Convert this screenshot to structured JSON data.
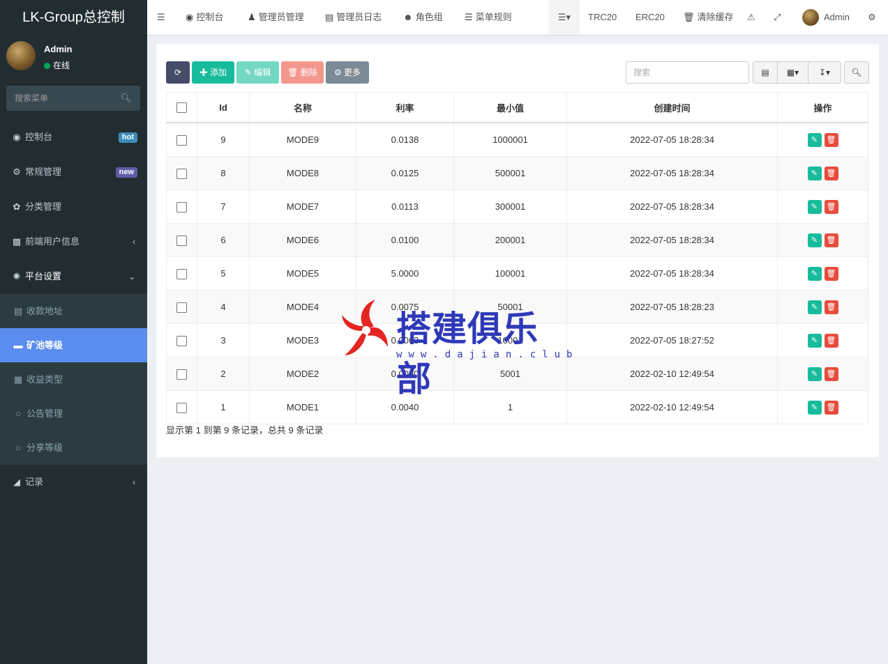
{
  "brand": "LK-Group总控制",
  "user": {
    "name": "Admin",
    "status": "在线"
  },
  "sidebar_search": {
    "placeholder": "搜索菜单"
  },
  "menu": {
    "items": [
      {
        "label": "控制台",
        "icon": "dashboard-icon",
        "badge": "hot"
      },
      {
        "label": "常规管理",
        "icon": "cogs-icon",
        "badge": "new"
      },
      {
        "label": "分类管理",
        "icon": "leaf-icon"
      },
      {
        "label": "前端用户信息",
        "icon": "user-card-icon"
      },
      {
        "label": "平台设置",
        "icon": "settings-icon"
      }
    ],
    "submenu": [
      {
        "label": "收款地址",
        "icon": "address-card-icon"
      },
      {
        "label": "矿池等级",
        "icon": "card-icon"
      },
      {
        "label": "收益类型",
        "icon": "windows-icon"
      },
      {
        "label": "公告管理",
        "icon": "circle-icon"
      },
      {
        "label": "分享等级",
        "icon": "circle-icon"
      }
    ],
    "records": {
      "label": "记录",
      "icon": "area-chart-icon"
    }
  },
  "header": {
    "nav": [
      "控制台",
      "管理员管理",
      "管理员日志",
      "角色组",
      "菜单规则"
    ],
    "trc": "TRC20",
    "erc": "ERC20",
    "clear_cache": "清除缓存",
    "admin": "Admin"
  },
  "toolbar": {
    "add": "添加",
    "edit": "编辑",
    "delete": "删除",
    "more": "更多",
    "search_placeholder": "搜索"
  },
  "table": {
    "columns": [
      "Id",
      "名称",
      "利率",
      "最小值",
      "创建时间",
      "操作"
    ],
    "rows": [
      {
        "id": "9",
        "name": "MODE9",
        "rate": "0.0138",
        "min": "1000001",
        "time": "2022-07-05 18:28:34"
      },
      {
        "id": "8",
        "name": "MODE8",
        "rate": "0.0125",
        "min": "500001",
        "time": "2022-07-05 18:28:34"
      },
      {
        "id": "7",
        "name": "MODE7",
        "rate": "0.0113",
        "min": "300001",
        "time": "2022-07-05 18:28:34"
      },
      {
        "id": "6",
        "name": "MODE6",
        "rate": "0.0100",
        "min": "200001",
        "time": "2022-07-05 18:28:34"
      },
      {
        "id": "5",
        "name": "MODE5",
        "rate": "5.0000",
        "min": "100001",
        "time": "2022-07-05 18:28:34"
      },
      {
        "id": "4",
        "name": "MODE4",
        "rate": "0.0075",
        "min": "50001",
        "time": "2022-07-05 18:28:23"
      },
      {
        "id": "3",
        "name": "MODE3",
        "rate": "0.0063",
        "min": "10001",
        "time": "2022-07-05 18:27:52"
      },
      {
        "id": "2",
        "name": "MODE2",
        "rate": "0.0050",
        "min": "5001",
        "time": "2022-02-10 12:49:54"
      },
      {
        "id": "1",
        "name": "MODE1",
        "rate": "0.0040",
        "min": "1",
        "time": "2022-02-10 12:49:54"
      }
    ]
  },
  "pageinfo": "显示第 1 到第 9 条记录，总共 9 条记录",
  "watermark": {
    "title": "搭建俱乐部",
    "url": "www.dajian.club"
  },
  "colors": {
    "sidebar": "#222d32",
    "active": "#5b8def",
    "success": "#18bc9c",
    "danger": "#e74c3c"
  }
}
